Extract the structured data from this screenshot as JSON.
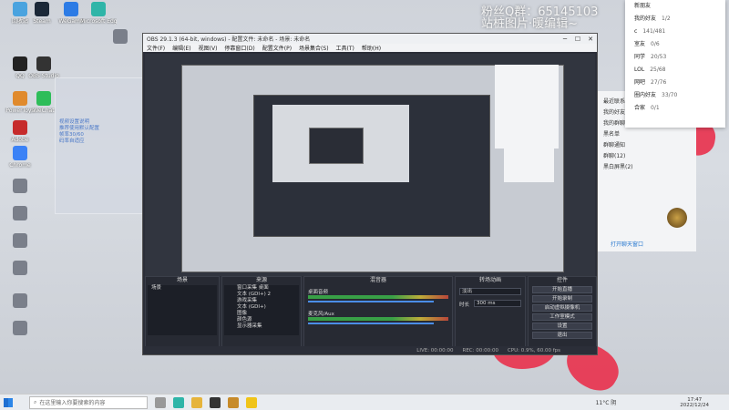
{
  "overlay": {
    "qq_line": "粉丝Q群：65145103",
    "subtitle": "站桩图片·暖编辑~"
  },
  "desktop_icons": [
    {
      "label": "回收站",
      "color": "#4aa3df"
    },
    {
      "label": "Steam",
      "color": "#1b2838"
    },
    {
      "label": "WeGame",
      "color": "#2c7be5"
    },
    {
      "label": "Microsoft Edge",
      "color": "#2fb5a8"
    },
    {
      "label": "QQ",
      "color": "#222222"
    },
    {
      "label": "OBS Studio",
      "color": "#333333"
    },
    {
      "label": "PowerToys",
      "color": "#e08a2c"
    },
    {
      "label": "WeChat",
      "color": "#2ebd59"
    },
    {
      "label": "Adobe",
      "color": "#c62b2b"
    },
    {
      "label": "Chrome",
      "color": "#3b82f6"
    }
  ],
  "obs": {
    "title": "OBS 29.1.3 (64-bit, windows) - 配置文件: 未命名 - 场景: 未命名",
    "menu": [
      "文件(F)",
      "编辑(E)",
      "视图(V)",
      "停靠窗口(D)",
      "配置文件(P)",
      "场景集合(S)",
      "工具(T)",
      "帮助(H)"
    ],
    "docks": {
      "scenes": "场景",
      "sources": "来源",
      "mixer": "混音器",
      "transitions": "转场动画",
      "controls": "控件"
    },
    "scene_items": [
      "场景"
    ],
    "source_items": [
      "窗口采集 桌面",
      "文本 (GDI+) 2",
      "游戏采集",
      "文本 (GDI+)",
      "图像",
      "颜色源",
      "显示器采集"
    ],
    "mixer_channels": [
      "桌面音频",
      "麦克风/Aux"
    ],
    "transition": {
      "name": "淡出",
      "duration_label": "时长",
      "duration": "300 ms"
    },
    "controls": [
      "开始直播",
      "开始录制",
      "启动虚拟摄像机",
      "工作室模式",
      "设置",
      "退出"
    ],
    "status": {
      "live": "LIVE: 00:00:00",
      "rec": "REC: 00:00:00",
      "cpu": "CPU: 0.9%, 60.00 fps"
    },
    "no_source": "未选择源"
  },
  "qq_panel": {
    "items": [
      "最近联系人",
      "我的好友",
      "我的群聊",
      "黑名单",
      "群聊通知",
      "群聊(12)",
      "黑白屏黑(2)"
    ],
    "bottom": "打开聊天窗口"
  },
  "dropdown": {
    "items": [
      {
        "label": "新朋友",
        "value": ""
      },
      {
        "label": "我的好友",
        "value": "1/2"
      },
      {
        "label": "c",
        "value": "141/481"
      },
      {
        "label": "室友",
        "value": "0/6"
      },
      {
        "label": "同学",
        "value": "20/53"
      },
      {
        "label": "LOL",
        "value": "25/68"
      },
      {
        "label": "网吧",
        "value": "27/76"
      },
      {
        "label": "圈内好友",
        "value": "33/70"
      },
      {
        "label": "合家",
        "value": "0/1"
      }
    ]
  },
  "taskbar": {
    "search_placeholder": "在这里输入你要搜索的内容",
    "weather": "11°C 阴",
    "time": "17:47",
    "date": "2022/12/24"
  }
}
